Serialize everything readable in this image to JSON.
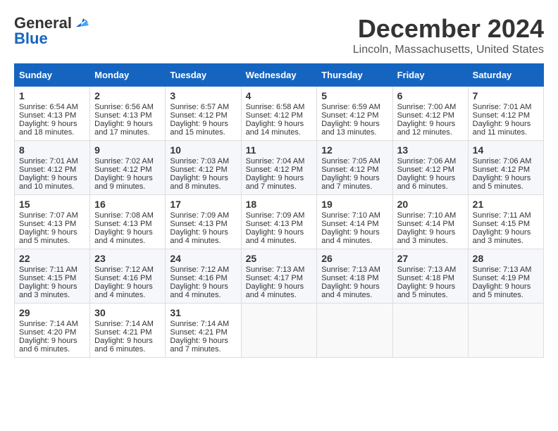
{
  "header": {
    "logo_line1": "General",
    "logo_line2": "Blue",
    "month_title": "December 2024",
    "location": "Lincoln, Massachusetts, United States"
  },
  "weekdays": [
    "Sunday",
    "Monday",
    "Tuesday",
    "Wednesday",
    "Thursday",
    "Friday",
    "Saturday"
  ],
  "weeks": [
    [
      {
        "day": "1",
        "sunrise": "6:54 AM",
        "sunset": "4:13 PM",
        "daylight": "9 hours and 18 minutes."
      },
      {
        "day": "2",
        "sunrise": "6:56 AM",
        "sunset": "4:13 PM",
        "daylight": "9 hours and 17 minutes."
      },
      {
        "day": "3",
        "sunrise": "6:57 AM",
        "sunset": "4:12 PM",
        "daylight": "9 hours and 15 minutes."
      },
      {
        "day": "4",
        "sunrise": "6:58 AM",
        "sunset": "4:12 PM",
        "daylight": "9 hours and 14 minutes."
      },
      {
        "day": "5",
        "sunrise": "6:59 AM",
        "sunset": "4:12 PM",
        "daylight": "9 hours and 13 minutes."
      },
      {
        "day": "6",
        "sunrise": "7:00 AM",
        "sunset": "4:12 PM",
        "daylight": "9 hours and 12 minutes."
      },
      {
        "day": "7",
        "sunrise": "7:01 AM",
        "sunset": "4:12 PM",
        "daylight": "9 hours and 11 minutes."
      }
    ],
    [
      {
        "day": "8",
        "sunrise": "7:01 AM",
        "sunset": "4:12 PM",
        "daylight": "9 hours and 10 minutes."
      },
      {
        "day": "9",
        "sunrise": "7:02 AM",
        "sunset": "4:12 PM",
        "daylight": "9 hours and 9 minutes."
      },
      {
        "day": "10",
        "sunrise": "7:03 AM",
        "sunset": "4:12 PM",
        "daylight": "9 hours and 8 minutes."
      },
      {
        "day": "11",
        "sunrise": "7:04 AM",
        "sunset": "4:12 PM",
        "daylight": "9 hours and 7 minutes."
      },
      {
        "day": "12",
        "sunrise": "7:05 AM",
        "sunset": "4:12 PM",
        "daylight": "9 hours and 7 minutes."
      },
      {
        "day": "13",
        "sunrise": "7:06 AM",
        "sunset": "4:12 PM",
        "daylight": "9 hours and 6 minutes."
      },
      {
        "day": "14",
        "sunrise": "7:06 AM",
        "sunset": "4:12 PM",
        "daylight": "9 hours and 5 minutes."
      }
    ],
    [
      {
        "day": "15",
        "sunrise": "7:07 AM",
        "sunset": "4:13 PM",
        "daylight": "9 hours and 5 minutes."
      },
      {
        "day": "16",
        "sunrise": "7:08 AM",
        "sunset": "4:13 PM",
        "daylight": "9 hours and 4 minutes."
      },
      {
        "day": "17",
        "sunrise": "7:09 AM",
        "sunset": "4:13 PM",
        "daylight": "9 hours and 4 minutes."
      },
      {
        "day": "18",
        "sunrise": "7:09 AM",
        "sunset": "4:13 PM",
        "daylight": "9 hours and 4 minutes."
      },
      {
        "day": "19",
        "sunrise": "7:10 AM",
        "sunset": "4:14 PM",
        "daylight": "9 hours and 4 minutes."
      },
      {
        "day": "20",
        "sunrise": "7:10 AM",
        "sunset": "4:14 PM",
        "daylight": "9 hours and 3 minutes."
      },
      {
        "day": "21",
        "sunrise": "7:11 AM",
        "sunset": "4:15 PM",
        "daylight": "9 hours and 3 minutes."
      }
    ],
    [
      {
        "day": "22",
        "sunrise": "7:11 AM",
        "sunset": "4:15 PM",
        "daylight": "9 hours and 3 minutes."
      },
      {
        "day": "23",
        "sunrise": "7:12 AM",
        "sunset": "4:16 PM",
        "daylight": "9 hours and 4 minutes."
      },
      {
        "day": "24",
        "sunrise": "7:12 AM",
        "sunset": "4:16 PM",
        "daylight": "9 hours and 4 minutes."
      },
      {
        "day": "25",
        "sunrise": "7:13 AM",
        "sunset": "4:17 PM",
        "daylight": "9 hours and 4 minutes."
      },
      {
        "day": "26",
        "sunrise": "7:13 AM",
        "sunset": "4:18 PM",
        "daylight": "9 hours and 4 minutes."
      },
      {
        "day": "27",
        "sunrise": "7:13 AM",
        "sunset": "4:18 PM",
        "daylight": "9 hours and 5 minutes."
      },
      {
        "day": "28",
        "sunrise": "7:13 AM",
        "sunset": "4:19 PM",
        "daylight": "9 hours and 5 minutes."
      }
    ],
    [
      {
        "day": "29",
        "sunrise": "7:14 AM",
        "sunset": "4:20 PM",
        "daylight": "9 hours and 6 minutes."
      },
      {
        "day": "30",
        "sunrise": "7:14 AM",
        "sunset": "4:21 PM",
        "daylight": "9 hours and 6 minutes."
      },
      {
        "day": "31",
        "sunrise": "7:14 AM",
        "sunset": "4:21 PM",
        "daylight": "9 hours and 7 minutes."
      },
      null,
      null,
      null,
      null
    ]
  ],
  "labels": {
    "sunrise": "Sunrise:",
    "sunset": "Sunset:",
    "daylight": "Daylight:"
  }
}
